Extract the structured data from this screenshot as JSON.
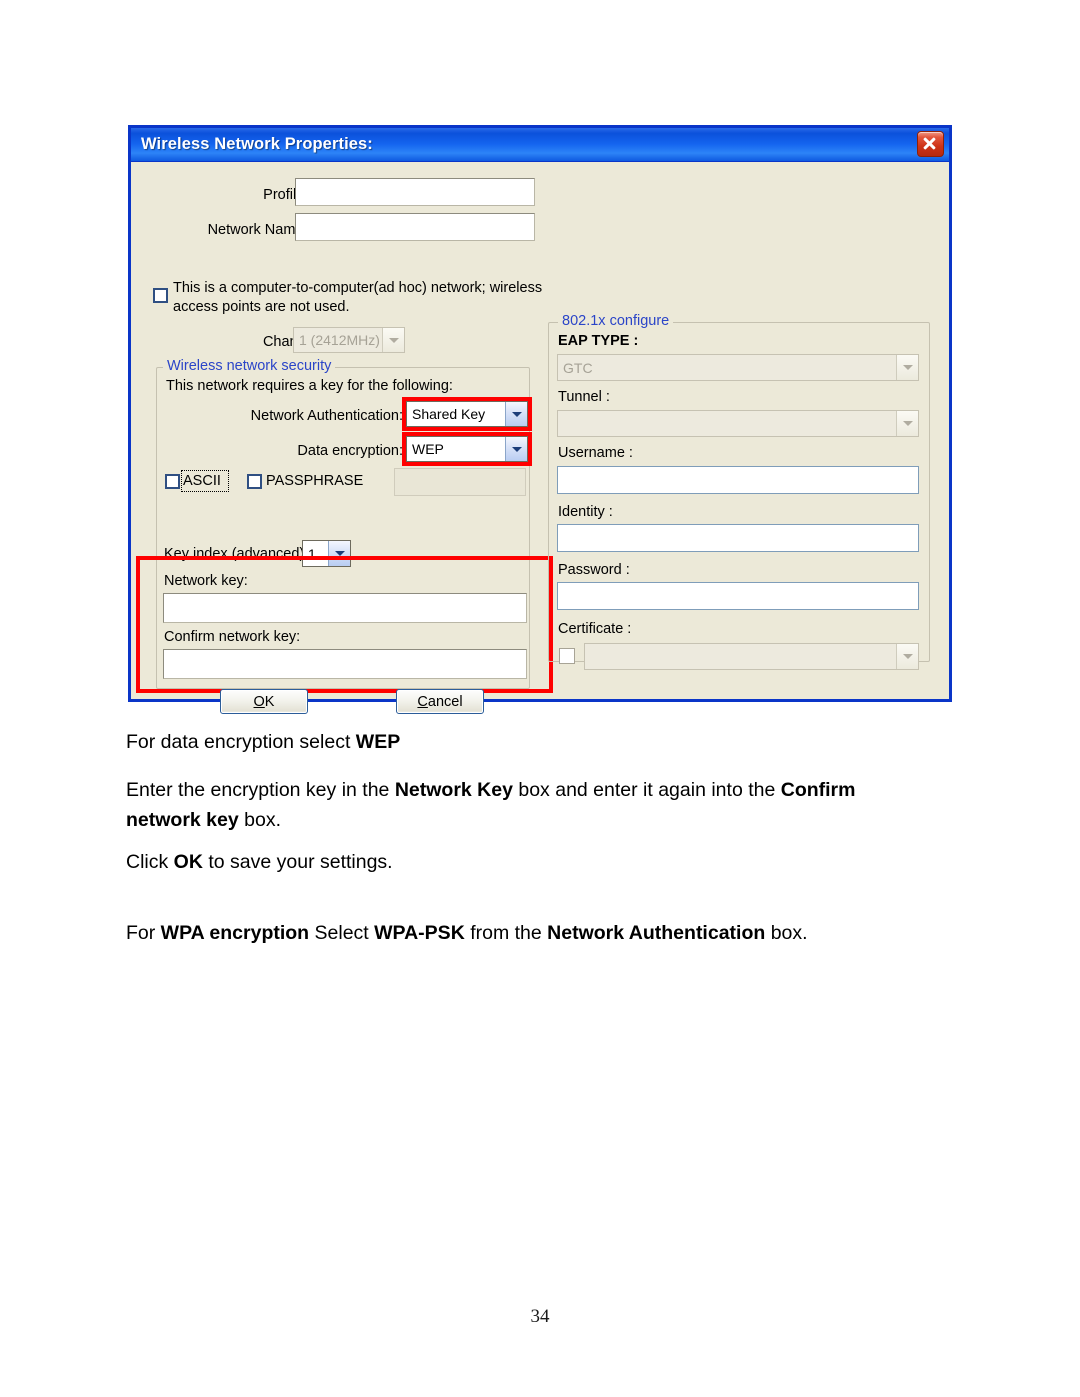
{
  "dialog": {
    "title": "Wireless Network Properties:",
    "close_icon": "close-icon",
    "fields": {
      "profile_name_label": "Profile Name:",
      "profile_name_value": "",
      "ssid_label": "Network Name(SSID):",
      "ssid_value": "",
      "adhoc_checkbox_label": "This is a computer-to-computer(ad hoc) network; wireless access points are not used.",
      "channel_label": "Channel:",
      "channel_value": "1 (2412MHz)"
    },
    "security_group": {
      "legend": "Wireless network security",
      "intro": "This network requires a key for the following:",
      "network_auth_label": "Network Authentication:",
      "network_auth_value": "Shared Key",
      "data_encryption_label": "Data encryption:",
      "data_encryption_value": "WEP",
      "ascii_label": "ASCII",
      "passphrase_label": "PASSPHRASE",
      "passphrase_value": "",
      "key_index_label": "Key index (advanced):",
      "key_index_value": "1",
      "network_key_label": "Network key:",
      "network_key_value": "",
      "confirm_key_label": "Confirm network key:",
      "confirm_key_value": ""
    },
    "dot1x_group": {
      "legend": "802.1x configure",
      "eap_type_label": "EAP TYPE :",
      "eap_type_value": "GTC",
      "tunnel_label": "Tunnel :",
      "tunnel_value": "",
      "username_label": "Username :",
      "username_value": "",
      "identity_label": "Identity :",
      "identity_value": "",
      "password_label": "Password :",
      "password_value": "",
      "certificate_label": "Certificate :",
      "certificate_value": ""
    },
    "buttons": {
      "ok_accel": "O",
      "ok_rest": "K",
      "cancel_accel": "C",
      "cancel_rest": "ancel"
    }
  },
  "body": {
    "p1_a": "For data encryption select ",
    "p1_b": "WEP",
    "p2_a": "Enter the encryption key in the ",
    "p2_b": "Network Key",
    "p2_c": " box and enter it again into the ",
    "p2_d": "Confirm network key",
    "p2_e": " box.",
    "p3_a": "Click ",
    "p3_b": "OK",
    "p3_c": " to save your settings.",
    "p4_a": "For ",
    "p4_b": "WPA encryption",
    "p4_c": " Select ",
    "p4_d": "WPA-PSK",
    "p4_e": " from the ",
    "p4_f": "Network Authentication",
    "p4_g": " box."
  },
  "page_number": "34",
  "colors": {
    "titlebar_blue": "#0b51db",
    "dialog_border": "#0a35c8",
    "dialog_face": "#ece9d8",
    "legend_blue": "#2b45c8",
    "highlight_red": "#ff0000"
  }
}
